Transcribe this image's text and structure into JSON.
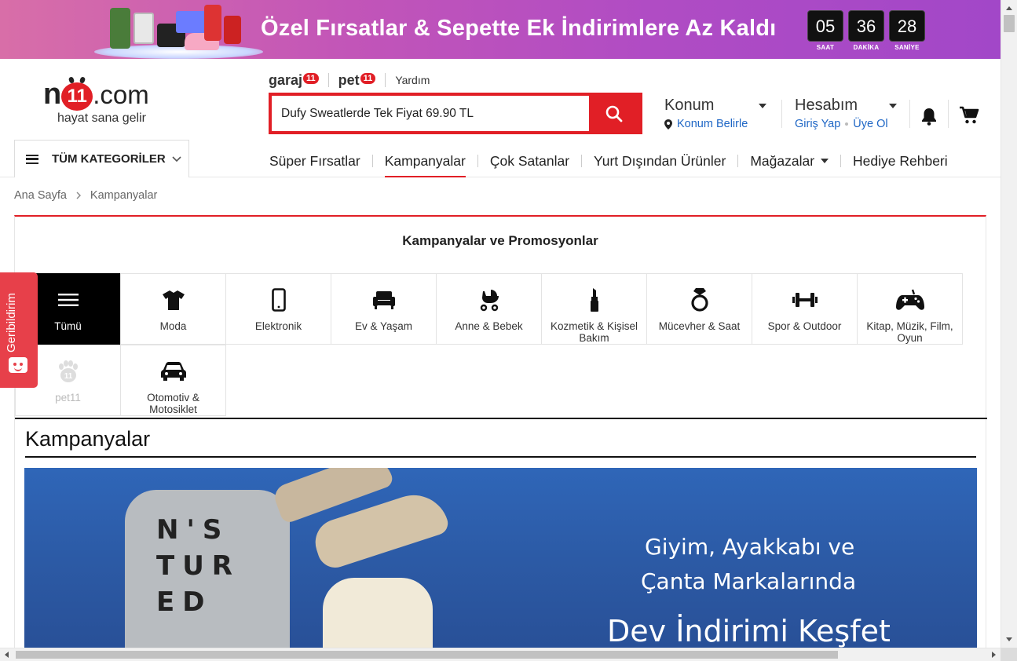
{
  "promo": {
    "text": "Özel Fırsatlar & Sepette Ek İndirimlere Az Kaldı",
    "countdown": [
      {
        "value": "05",
        "label": "SAAT"
      },
      {
        "value": "36",
        "label": "DAKİKA"
      },
      {
        "value": "28",
        "label": "SANİYE"
      }
    ]
  },
  "logo": {
    "n": "n",
    "eleven": "11",
    "com": ".com",
    "slogan": "hayat sana gelir"
  },
  "sub_links": {
    "garaj": "garaj",
    "garaj_badge": "11",
    "pet": "pet",
    "pet_badge": "11",
    "help": "Yardım"
  },
  "search": {
    "value": "Dufy Sweatlerde Tek Fiyat 69.90 TL"
  },
  "location": {
    "title": "Konum",
    "action": "Konum Belirle"
  },
  "account": {
    "title": "Hesabım",
    "login": "Giriş Yap",
    "register": "Üye Ol"
  },
  "all_categories": {
    "label": "TÜM KATEGORİLER"
  },
  "nav": {
    "items": [
      "Süper Fırsatlar",
      "Kampanyalar",
      "Çok Satanlar",
      "Yurt Dışından Ürünler",
      "Mağazalar",
      "Hediye Rehberi"
    ],
    "active": "Kampanyalar"
  },
  "breadcrumb": {
    "home": "Ana Sayfa",
    "current": "Kampanyalar"
  },
  "section": {
    "title": "Kampanyalar ve Promosyonlar"
  },
  "categories": [
    {
      "label": "Tümü",
      "icon": "menu-icon"
    },
    {
      "label": "Moda",
      "icon": "tshirt-icon"
    },
    {
      "label": "Elektronik",
      "icon": "phone-icon"
    },
    {
      "label": "Ev & Yaşam",
      "icon": "armchair-icon"
    },
    {
      "label": "Anne & Bebek",
      "icon": "stroller-icon"
    },
    {
      "label": "Kozmetik & Kişisel Bakım",
      "icon": "lipstick-icon"
    },
    {
      "label": "Mücevher & Saat",
      "icon": "ring-icon"
    },
    {
      "label": "Spor & Outdoor",
      "icon": "dumbbell-icon"
    },
    {
      "label": "Kitap, Müzik, Film, Oyun",
      "icon": "gamepad-icon"
    },
    {
      "label": "pet11",
      "icon": "paw-icon"
    },
    {
      "label": "Otomotiv & Motosiklet",
      "icon": "car-icon"
    }
  ],
  "kampanyalar": {
    "title": "Kampanyalar"
  },
  "hero": {
    "line1": "Giyim, Ayakkabı ve",
    "line2": "Çanta Markalarında",
    "line3": "Dev İndirimi Keşfet",
    "sweater_text": "N'S TURED"
  },
  "feedback": {
    "label": "Geribildirim"
  },
  "colors": {
    "brand_red": "#e11f26",
    "link_blue": "#1e66c5",
    "promo_start": "#d86ea8",
    "promo_end": "#a247c8",
    "hero_blue": "#2c5aa5"
  }
}
